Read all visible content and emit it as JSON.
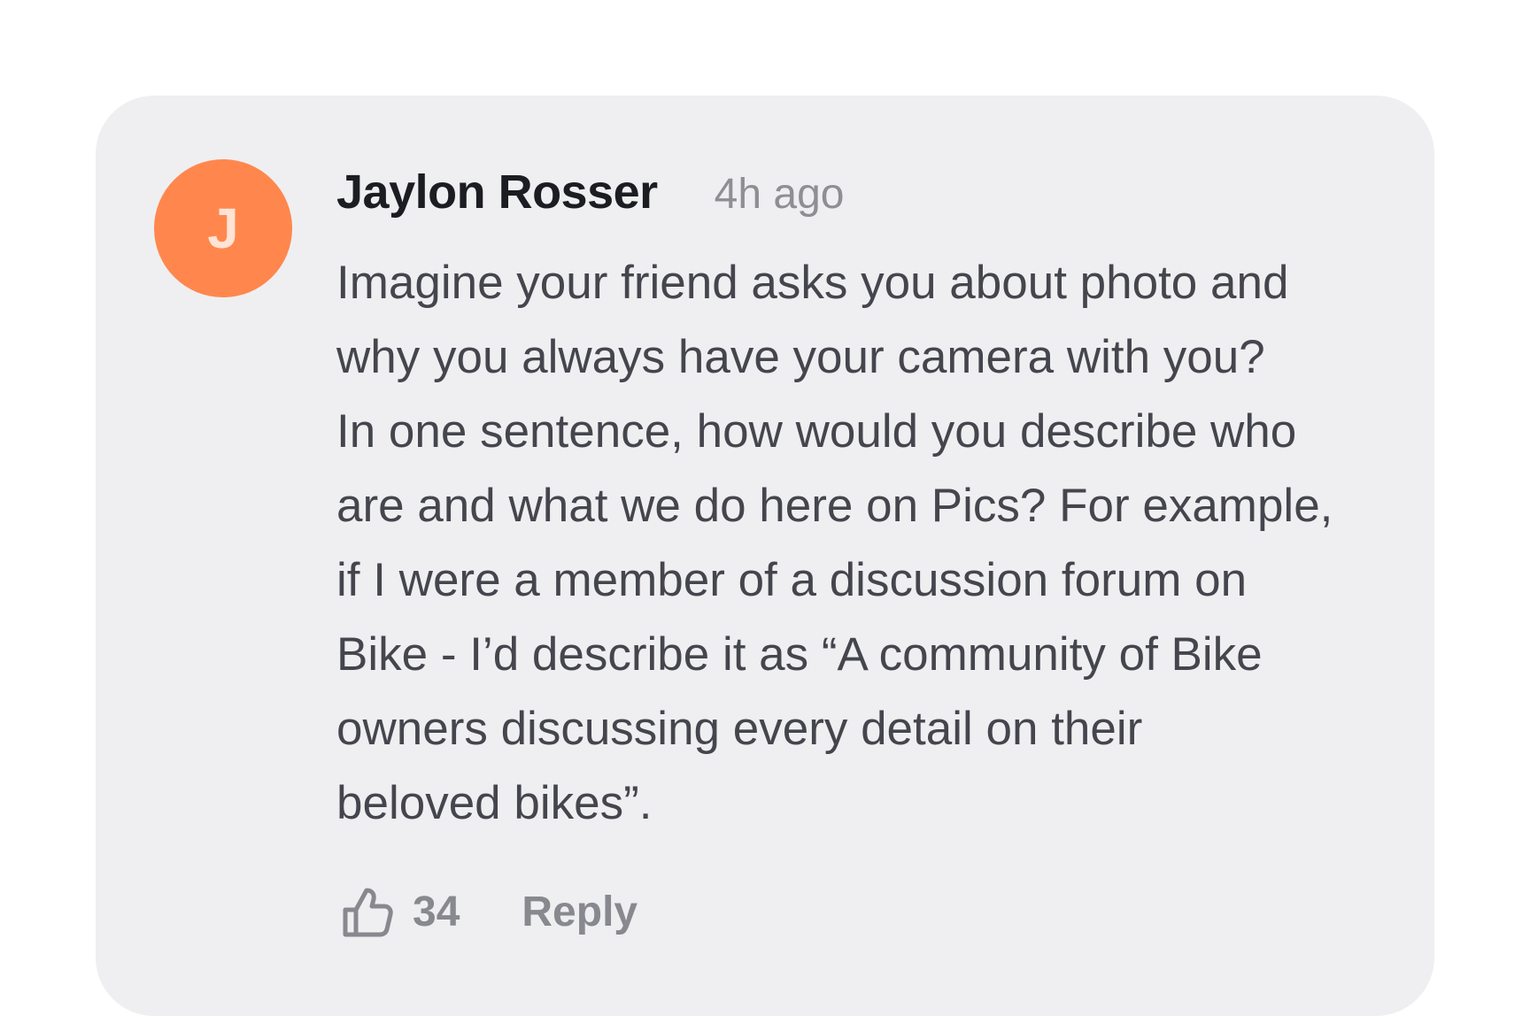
{
  "comment": {
    "avatar_initial": "J",
    "author": "Jaylon Rosser",
    "timestamp": "4h ago",
    "body": "Imagine your friend asks you about photo and\nwhy you always have your camera with you?\nIn one sentence, how would you describe who\nare and what we do here on Pics? For example,\nif I were a member of a discussion forum on\nBike - I’d describe it as “A community of Bike\nowners discussing every detail on their\nbeloved bikes”.",
    "like_count": "34",
    "reply_label": "Reply"
  },
  "icons": {
    "like": "thumbs-up-icon"
  },
  "colors": {
    "card_background": "#efeff1",
    "avatar_background": "#ff874d",
    "author": "#1c1d22",
    "body": "#45464d",
    "muted": "#88898f"
  }
}
